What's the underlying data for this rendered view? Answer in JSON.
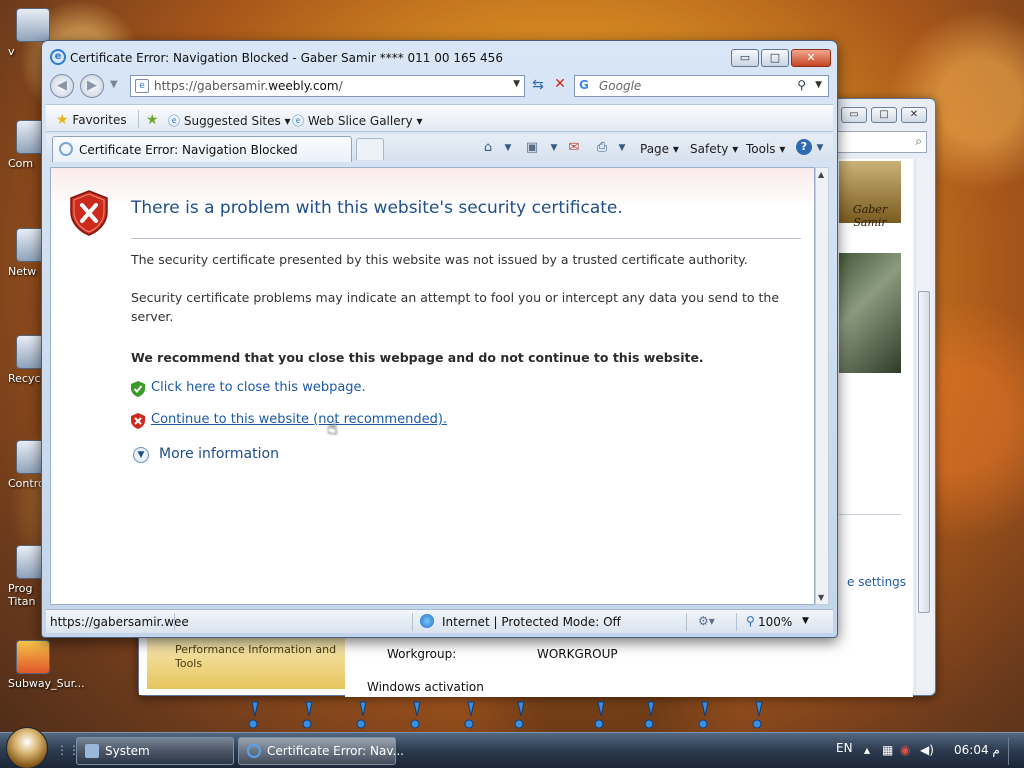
{
  "desktop": {
    "icons": [
      {
        "label": "v"
      },
      {
        "label": "Com"
      },
      {
        "label": "Netw"
      },
      {
        "label": "Recyc"
      },
      {
        "label": "Contro"
      },
      {
        "label": "Prog"
      },
      {
        "label": "Titan"
      },
      {
        "label": "Subway_Sur..."
      }
    ]
  },
  "back_window": {
    "controls": {
      "minimize": "▭",
      "maximize": "□",
      "close": "✕"
    },
    "search_icon": "search-icon",
    "logo_text": "Gaber Samir",
    "settings_link": "e settings",
    "performance_text": "Performance Information and Tools",
    "workgroup_label": "Workgroup:",
    "workgroup_value": "WORKGROUP",
    "activation_label": "Windows activation"
  },
  "ie": {
    "title": "Certificate Error: Navigation Blocked - Gaber Samir **** 011 00 165 456",
    "controls": {
      "minimize": "▭",
      "maximize": "□",
      "close": "✕"
    },
    "url_prefix": "https://gabersamir.",
    "url_domain": "weebly.com",
    "url_suffix": "/",
    "search_engine_glyph": "G",
    "search_placeholder": "Google",
    "favorites_label": "Favorites",
    "suggested_sites_label": "Suggested Sites ▾",
    "web_slice_label": "Web Slice Gallery ▾",
    "tab_label": "Certificate Error: Navigation Blocked",
    "commands": {
      "page": "Page ▾",
      "safety": "Safety ▾",
      "tools": "Tools ▾",
      "help": "?"
    },
    "content": {
      "heading": "There is a problem with this website's security certificate.",
      "para1": "The security certificate presented by this website was not issued by a trusted certificate authority.",
      "para2": "Security certificate problems may indicate an attempt to fool you or intercept any data you send to the server.",
      "recommend": "We recommend that you close this webpage and do not continue to this website.",
      "close_link": "Click here to close this webpage.",
      "continue_link": "Continue to this website (not recommended).",
      "more_info": "More information"
    },
    "status": {
      "url": "https://gabersamir.wee",
      "zone": "Internet | Protected Mode: Off",
      "zoom": "100%"
    }
  },
  "taskbar": {
    "buttons": [
      {
        "label": "System"
      },
      {
        "label": "Certificate Error: Nav..."
      }
    ],
    "lang": "EN",
    "clock": "06:04 م"
  },
  "colors": {
    "link": "#1b5aa6",
    "heading": "#1f4e8b",
    "error_red": "#cc2a1b",
    "safe_green": "#3a9a2a"
  }
}
